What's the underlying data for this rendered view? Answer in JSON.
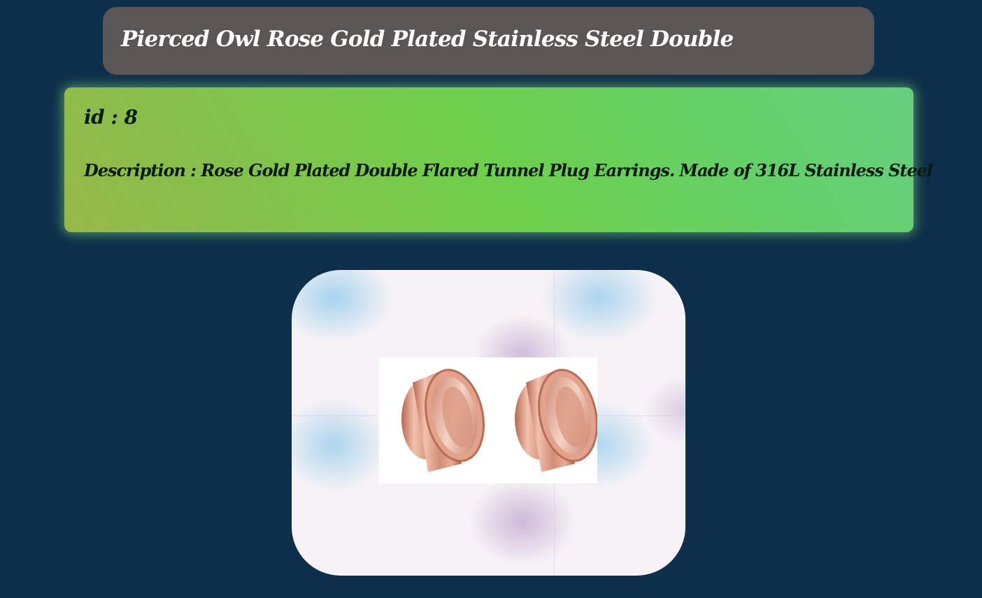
{
  "product": {
    "title": "Pierced Owl Rose Gold Plated Stainless Steel Double",
    "id_text": "id : 8",
    "description_text": "Description : Rose Gold Plated Double Flared Tunnel Plug Earrings. Made of 316L Stainless Steel"
  },
  "colors": {
    "page_background": "#0e2f4b",
    "title_bar": "#5c5555",
    "card_gradient_start": "#97b84a",
    "card_gradient_end": "#65cf7f",
    "rose_gold": "#d4917a"
  },
  "image": {
    "subject": "rose-gold-tunnel-plug-earrings-icon"
  }
}
